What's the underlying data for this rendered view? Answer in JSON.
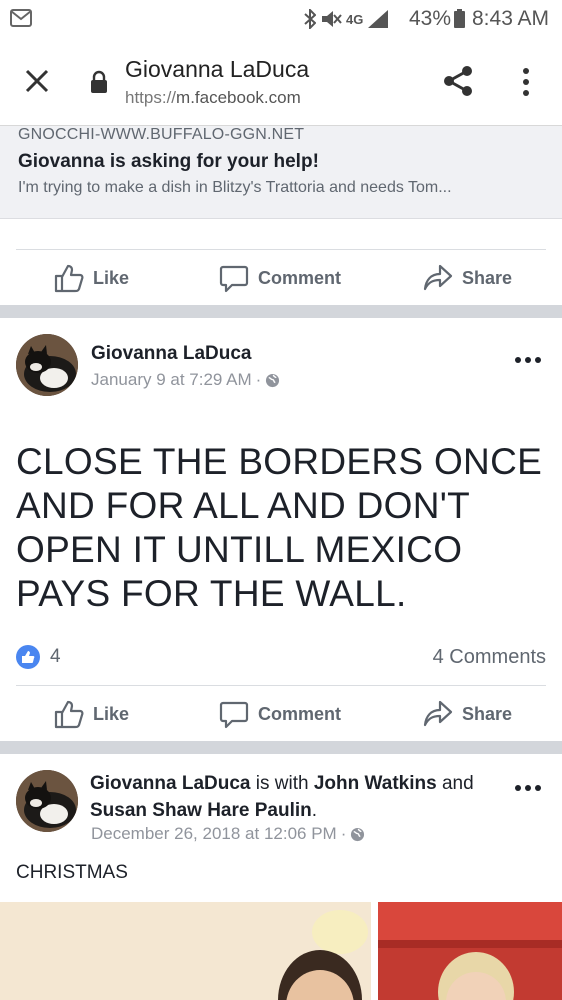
{
  "status_bar": {
    "network": "4G",
    "battery": "43%",
    "time": "8:43 AM"
  },
  "browser": {
    "title": "Giovanna LaDuca",
    "url_protocol": "https://",
    "url_host": "m.facebook.com"
  },
  "shared_link": {
    "domain": "GNOCCHI-WWW.BUFFALO-GGN.NET",
    "headline": "Giovanna is asking for your help!",
    "description": "I'm trying to make a dish in Blitzy's Trattoria and needs Tom..."
  },
  "actions": {
    "like": "Like",
    "comment": "Comment",
    "share": "Share"
  },
  "post1": {
    "author": "Giovanna LaDuca",
    "date": "January 9 at 7:29 AM",
    "separator": "·",
    "text": "CLOSE THE BORDERS ONCE AND FOR ALL AND DON'T OPEN IT UNTILL MEXICO PAYS FOR THE WALL.",
    "like_count": "4",
    "comment_count": "4 Comments"
  },
  "post2": {
    "author": "Giovanna LaDuca",
    "with_word": "is with",
    "tag1": "John Watkins",
    "and_word": "and",
    "tag2": "Susan Shaw Hare Paulin",
    "period": ".",
    "date": "December 26, 2018 at 12:06 PM",
    "separator": "·",
    "caption": "CHRISTMAS"
  },
  "colors": {
    "facebook_blue": "#4a86f0",
    "gray_text": "#606770",
    "divider": "#d3d6db"
  }
}
